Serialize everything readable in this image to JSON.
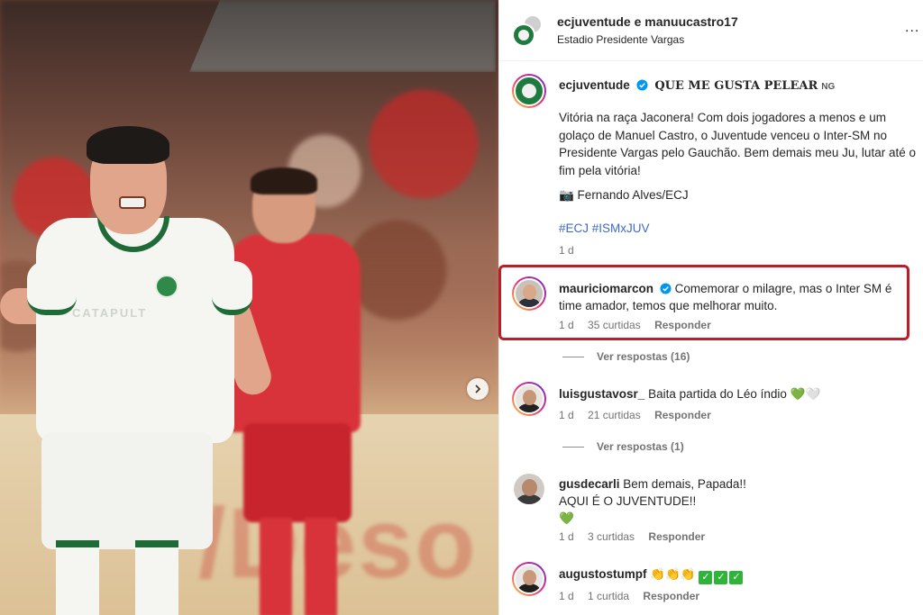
{
  "header": {
    "title": "ecjuventude e manuucastro17",
    "location": "Estadio Presidente Vargas",
    "more": "..."
  },
  "photo": {
    "sponsor": "CATAPULT",
    "banner": "/Deso",
    "next_arrow": "›"
  },
  "caption": {
    "username": "ecjuventude",
    "tagline": "QUE ME GUSTA PELEAR",
    "tagline_suffix": "NG",
    "text": "Vitória na raça Jaconera! Com dois jogadores a menos e um golaço de Manuel Castro, o Juventude venceu o Inter-SM no Presidente Vargas pelo Gauchão. Bem demais meu Ju, lutar até o fim pela vitória!",
    "credit": "📷 Fernando Alves/ECJ",
    "hashtags": "#ECJ #ISMxJUV",
    "time": "1 d"
  },
  "comments": [
    {
      "username": "mauriciomarcon",
      "verified": true,
      "text": "Comemorar o milagre, mas o Inter SM é time amador, temos que melhorar muito.",
      "time": "1 d",
      "likes": "35 curtidas",
      "reply": "Responder",
      "view_replies": "Ver respostas (16)",
      "highlighted": true
    },
    {
      "username": "luisgustavosr_",
      "text": "Baita partida do Léo índio",
      "emoji": "💚🤍",
      "time": "1 d",
      "likes": "21 curtidas",
      "reply": "Responder",
      "view_replies": "Ver respostas (1)"
    },
    {
      "username": "gusdecarli",
      "text_line1": "Bem demais, Papada!!",
      "text_line2": "AQUI É O JUVENTUDE!!",
      "emoji": "💚",
      "time": "1 d",
      "likes": "3 curtidas",
      "reply": "Responder"
    },
    {
      "username": "augustostumpf",
      "emoji": "👏👏👏",
      "checks": [
        "✓",
        "✓",
        "✓"
      ],
      "time": "1 d",
      "likes": "1 curtida",
      "reply": "Responder"
    }
  ],
  "colors": {
    "highlight_border": "#b81f2a",
    "link_blue": "#3d6bc2",
    "verified_blue": "#0095f6",
    "juventude_green": "#1f7a3d"
  }
}
